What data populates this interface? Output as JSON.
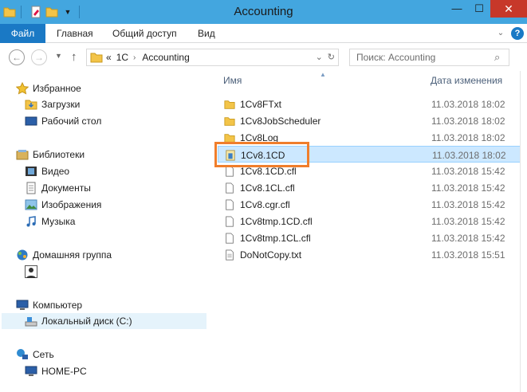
{
  "window": {
    "title": "Accounting",
    "controls": {
      "minimize": "—",
      "maximize": "☐",
      "close": "✕"
    }
  },
  "ribbon": {
    "tabs": [
      "Файл",
      "Главная",
      "Общий доступ",
      "Вид"
    ]
  },
  "address": {
    "back": "←",
    "forward": "→",
    "up": "↑",
    "overflow": "«",
    "crumbs": [
      "1C",
      "Accounting"
    ],
    "search_placeholder": "Поиск: Accounting"
  },
  "nav": {
    "favorites": {
      "label": "Избранное",
      "items": [
        "Загрузки",
        "Рабочий стол"
      ]
    },
    "libraries": {
      "label": "Библиотеки",
      "items": [
        "Видео",
        "Документы",
        "Изображения",
        "Музыка"
      ]
    },
    "homegroup": {
      "label": "Домашняя группа"
    },
    "computer": {
      "label": "Компьютер",
      "items": [
        "Локальный диск (C:)"
      ]
    },
    "network": {
      "label": "Сеть",
      "items": [
        "HOME-PC"
      ]
    }
  },
  "columns": {
    "name": "Имя",
    "date": "Дата изменения"
  },
  "files": [
    {
      "name": "1Cv8FTxt",
      "date": "11.03.2018 18:02",
      "type": "folder"
    },
    {
      "name": "1Cv8JobScheduler",
      "date": "11.03.2018 18:02",
      "type": "folder"
    },
    {
      "name": "1Cv8Log",
      "date": "11.03.2018 18:02",
      "type": "folder"
    },
    {
      "name": "1Cv8.1CD",
      "date": "11.03.2018 18:02",
      "type": "db"
    },
    {
      "name": "1Cv8.1CD.cfl",
      "date": "11.03.2018 15:42",
      "type": "file"
    },
    {
      "name": "1Cv8.1CL.cfl",
      "date": "11.03.2018 15:42",
      "type": "file"
    },
    {
      "name": "1Cv8.cgr.cfl",
      "date": "11.03.2018 15:42",
      "type": "file"
    },
    {
      "name": "1Cv8tmp.1CD.cfl",
      "date": "11.03.2018 15:42",
      "type": "file"
    },
    {
      "name": "1Cv8tmp.1CL.cfl",
      "date": "11.03.2018 15:42",
      "type": "file"
    },
    {
      "name": "DoNotCopy.txt",
      "date": "11.03.2018 15:51",
      "type": "txt"
    }
  ],
  "colors": {
    "titlebar": "#43a6df",
    "file_tab": "#1a79c5",
    "selection": "#cce8ff",
    "highlight": "#f07e2c"
  }
}
